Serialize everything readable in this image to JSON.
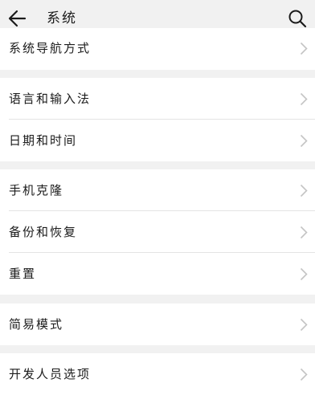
{
  "header": {
    "title": "系统",
    "back_icon": "back-arrow-icon",
    "search_icon": "search-icon"
  },
  "groups": [
    {
      "items": [
        {
          "label": "系统导航方式"
        }
      ]
    },
    {
      "items": [
        {
          "label": "语言和输入法"
        },
        {
          "label": "日期和时间"
        }
      ]
    },
    {
      "items": [
        {
          "label": "手机克隆"
        },
        {
          "label": "备份和恢复"
        },
        {
          "label": "重置"
        }
      ]
    },
    {
      "items": [
        {
          "label": "简易模式"
        }
      ]
    },
    {
      "items": [
        {
          "label": "开发人员选项"
        }
      ]
    }
  ],
  "colors": {
    "background": "#f1f1f1",
    "card": "#ffffff",
    "text": "#1b1b1b",
    "chevron": "#c4c4c4"
  }
}
